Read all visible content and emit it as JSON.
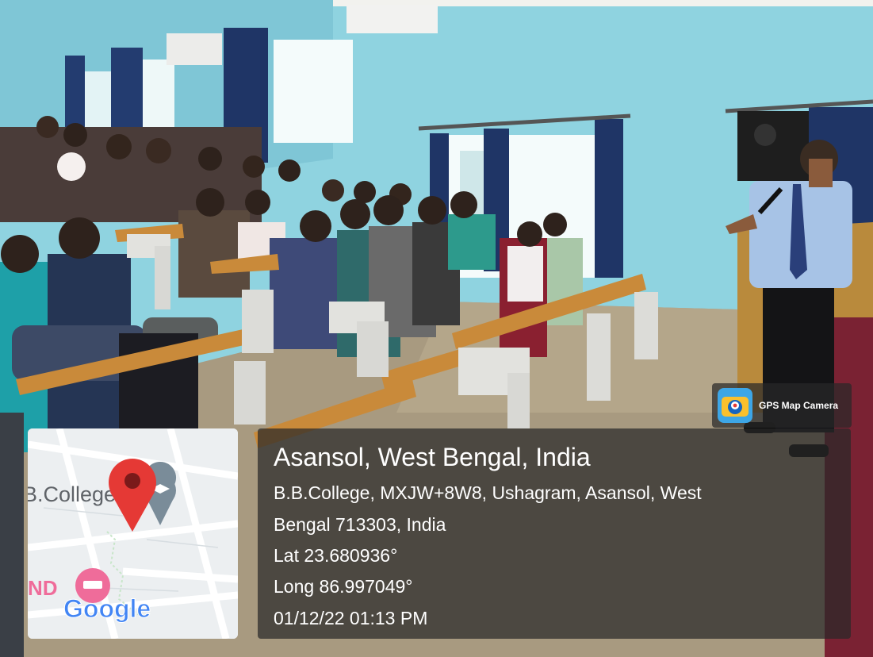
{
  "overlay": {
    "app_label": "GPS Map Camera",
    "location_title": "Asansol, West Bengal, India",
    "address_line_1": "B.B.College, MXJW+8W8, Ushagram, Asansol, West",
    "address_line_2": "Bengal 713303, India",
    "latitude": "Lat 23.680936°",
    "longitude": "Long 86.997049°",
    "timestamp": "01/12/22 01:13 PM"
  },
  "map": {
    "place_label": "B.College",
    "poi_label": "ND",
    "brand": "Google",
    "pin_color": "#e53935"
  },
  "colors": {
    "wall": "#8fd3e0",
    "curtain": "#1f3566",
    "bench": "#c98a3a",
    "panel_bg": "rgba(40,40,40,0.72)"
  }
}
